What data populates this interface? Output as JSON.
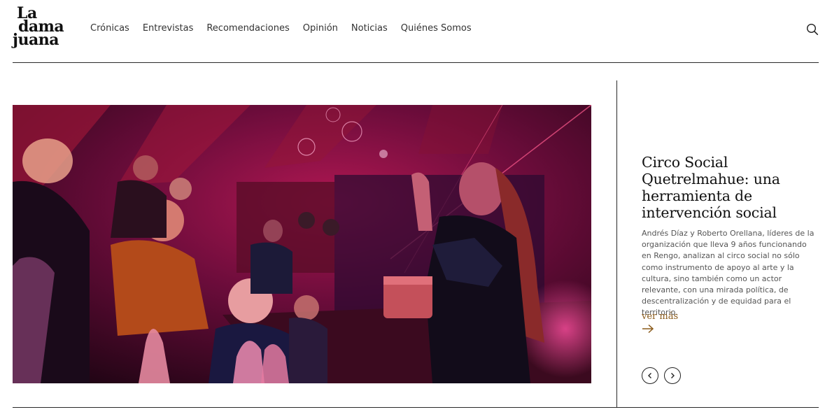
{
  "logo": {
    "line1": "La",
    "line2": "dama",
    "line3": "juana"
  },
  "nav": [
    {
      "label": "Crónicas"
    },
    {
      "label": "Entrevistas"
    },
    {
      "label": "Recomendaciones"
    },
    {
      "label": "Opinión"
    },
    {
      "label": "Noticias"
    },
    {
      "label": "Quiénes Somos"
    }
  ],
  "icons": {
    "search": "search-icon",
    "arrow": "arrow-right-icon",
    "prev": "chevron-left-icon",
    "next": "chevron-right-icon"
  },
  "featured": {
    "title": "Circo Social Quetrelmahue: una herramienta de intervención social",
    "excerpt": "Andrés Díaz y Roberto Orellana, líderes de la organización que lleva 9 años funcionando en Rengo, analizan al circo social no sólo como instrumento de apoyo al arte y la cultura, sino también como un actor relevante, con una mirada política, de descentralización y de equidad para el territorio.",
    "read_more": "ver más"
  },
  "colors": {
    "accent": "#8a5a1a",
    "text": "#111111",
    "muted": "#555555",
    "rule": "#2a2a2a"
  }
}
